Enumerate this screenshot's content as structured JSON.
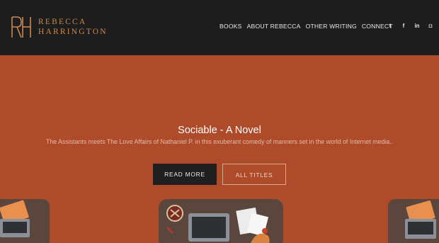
{
  "header": {
    "logo_line1": "REBECCA",
    "logo_line2": "HARRINGTON",
    "nav": [
      "BOOKS",
      "ABOUT REBECCA",
      "OTHER WRITING",
      "CONNECT"
    ],
    "social_icons": [
      "twitter-icon",
      "facebook-icon",
      "linkedin-icon",
      "instagram-icon"
    ],
    "social_glyphs": [
      "t",
      "f",
      "in",
      "◘"
    ]
  },
  "hero": {
    "title": "Sociable - A Novel",
    "subtitle": "The Assistants meets The Love Affairs of Nathaniel P. in this exuberant comedy of manners set in the world of Internet media..",
    "read_more": "READ MORE",
    "all_titles": "ALL TITLES"
  },
  "colors": {
    "background": "#ad4b2b",
    "header": "#1d1d1d",
    "logo": "#c98a4e"
  }
}
